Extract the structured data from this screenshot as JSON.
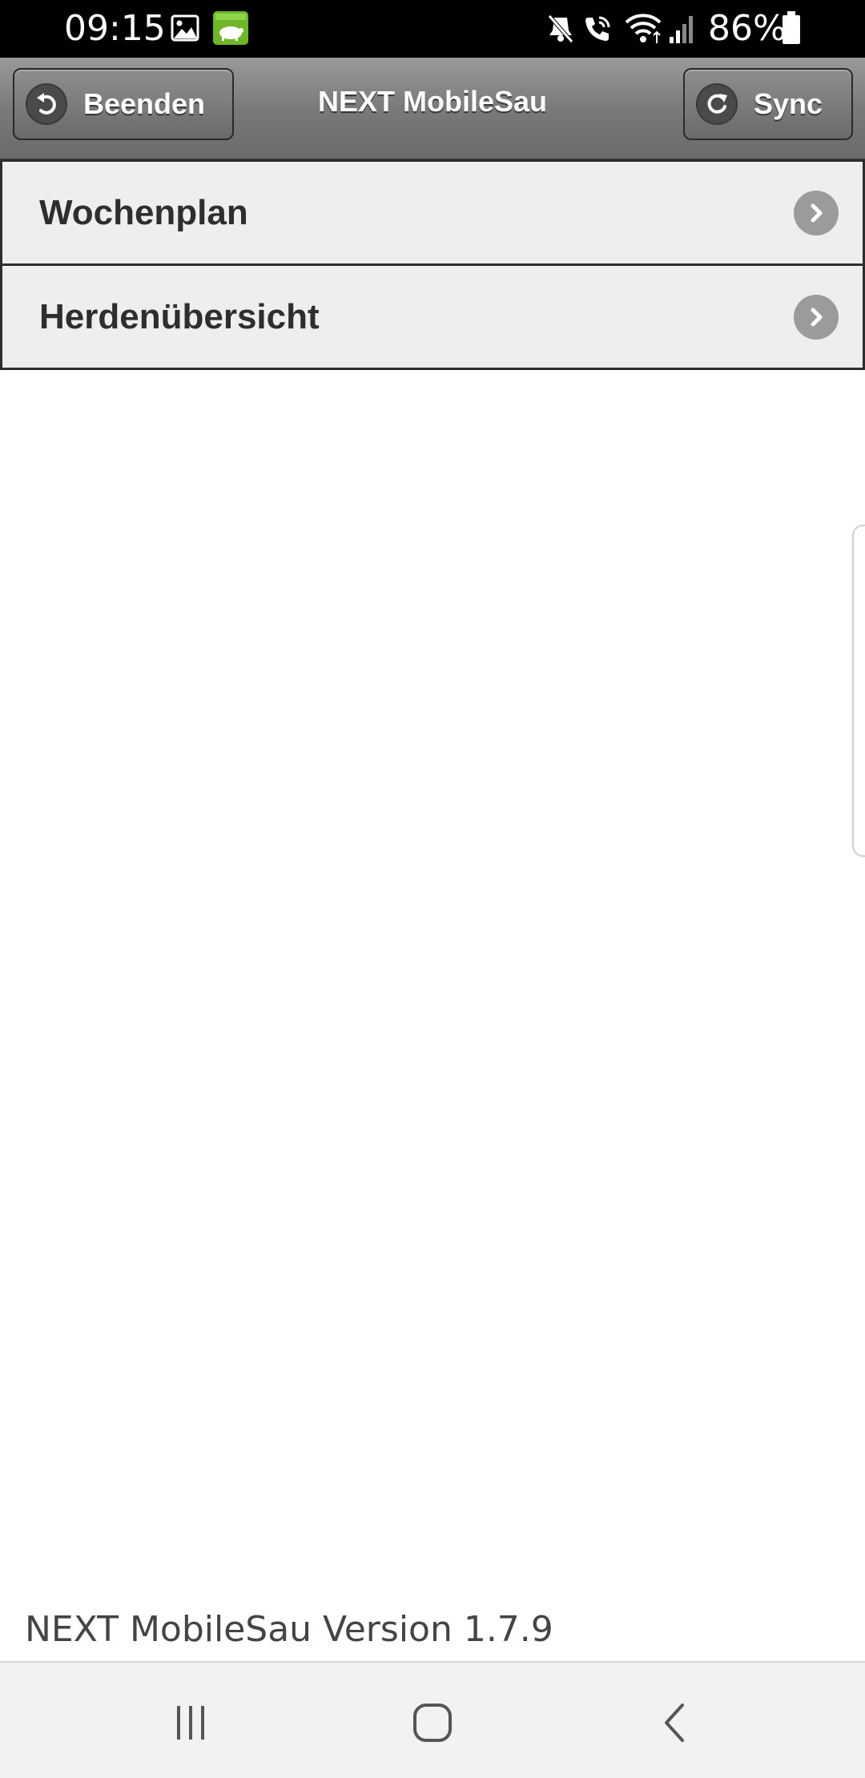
{
  "status_bar": {
    "time": "09:15",
    "battery": "86%",
    "icons": [
      "image-icon",
      "pig-app-icon",
      "mute-icon",
      "wifi-call-icon",
      "wifi-icon",
      "signal-icon",
      "battery-icon"
    ]
  },
  "header": {
    "title": "NEXT MobileSau",
    "left_button": {
      "label": "Beenden",
      "icon": "back-arrow-icon"
    },
    "right_button": {
      "label": "Sync",
      "icon": "refresh-icon"
    }
  },
  "menu": {
    "items": [
      {
        "label": "Wochenplan",
        "icon": "chevron-right-icon"
      },
      {
        "label": "Herdenübersicht",
        "icon": "chevron-right-icon"
      }
    ]
  },
  "footer": {
    "version": "NEXT MobileSau Version 1.7.9"
  },
  "nav_bar": {
    "buttons": [
      "recents-icon",
      "home-icon",
      "back-icon"
    ]
  },
  "colors": {
    "header_gradient_top": "#9a9a9a",
    "header_gradient_bottom": "#6a6a6a",
    "menu_background": "#eeeeee",
    "app_icon_green": "#6fb629"
  }
}
